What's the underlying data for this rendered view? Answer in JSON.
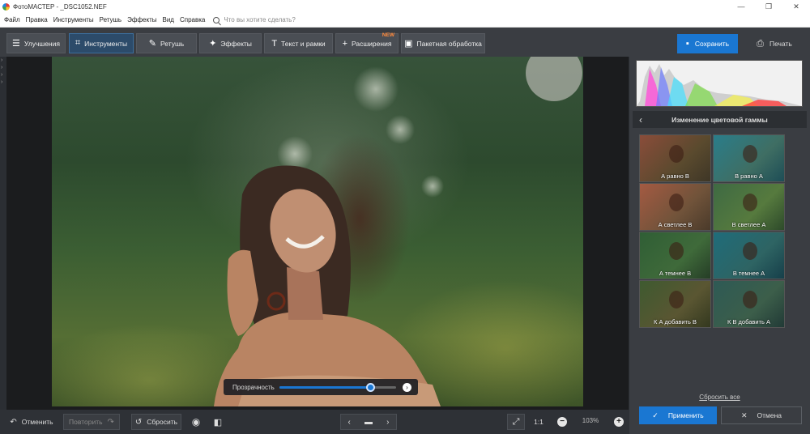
{
  "window": {
    "title": "ФотоМАСТЕР - _DSC1052.NEF"
  },
  "menu": {
    "items": [
      "Файл",
      "Правка",
      "Инструменты",
      "Ретушь",
      "Эффекты",
      "Вид",
      "Справка"
    ],
    "search_placeholder": "Что вы хотите сделать?"
  },
  "toolbar": {
    "tabs": [
      {
        "label": "Улучшения",
        "icon": "sliders-icon"
      },
      {
        "label": "Инструменты",
        "icon": "crop-icon",
        "active": true
      },
      {
        "label": "Ретушь",
        "icon": "brush-icon"
      },
      {
        "label": "Эффекты",
        "icon": "sparkle-icon"
      },
      {
        "label": "Текст и рамки",
        "icon": "text-icon"
      },
      {
        "label": "Расширения",
        "icon": "plus-icon",
        "badge": "NEW"
      },
      {
        "label": "Пакетная обработка",
        "icon": "images-icon"
      }
    ],
    "save_label": "Сохранить",
    "print_label": "Печать"
  },
  "canvas": {
    "opacity_label": "Прозрачность",
    "opacity_value": 0.78
  },
  "panel": {
    "title": "Изменение цветовой гаммы",
    "presets": [
      {
        "label": "А равно В"
      },
      {
        "label": "В равно А"
      },
      {
        "label": "А светлее В"
      },
      {
        "label": "В светлее А"
      },
      {
        "label": "А темнее В"
      },
      {
        "label": "В темнее А"
      },
      {
        "label": "К А добавить В"
      },
      {
        "label": "К В добавить А"
      }
    ],
    "reset_all_label": "Сбросить все",
    "apply_label": "Применить",
    "cancel_label": "Отмена"
  },
  "bottom": {
    "undo_label": "Отменить",
    "redo_label": "Повторить",
    "reset_label": "Сбросить",
    "zoom_ratio_label": "1:1",
    "zoom_level": "103%"
  },
  "colors": {
    "accent": "#1a77d2",
    "new_badge": "#ff8a3c",
    "panel_bg": "#3a3d42",
    "canvas_bg": "#1b1c1e"
  }
}
